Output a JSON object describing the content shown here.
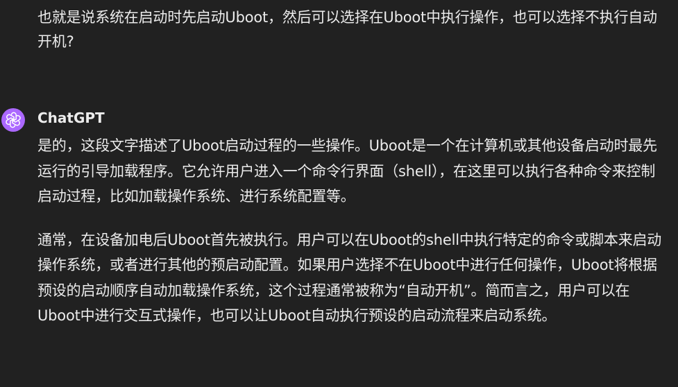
{
  "user_message": {
    "text": "也就是说系统在启动时先启动Uboot，然后可以选择在Uboot中执行操作，也可以选择不执行自动开机?"
  },
  "assistant": {
    "author": "ChatGPT",
    "avatar_icon": "openai-logo-icon",
    "avatar_color": "#ab68ff",
    "paragraphs": [
      "是的，这段文字描述了Uboot启动过程的一些操作。Uboot是一个在计算机或其他设备启动时最先运行的引导加载程序。它允许用户进入一个命令行界面（shell），在这里可以执行各种命令来控制启动过程，比如加载操作系统、进行系统配置等。",
      "通常，在设备加电后Uboot首先被执行。用户可以在Uboot的shell中执行特定的命令或脚本来启动操作系统，或者进行其他的预启动配置。如果用户选择不在Uboot中进行任何操作，Uboot将根据预设的启动顺序自动加载操作系统，这个过程通常被称为“自动开机”。简而言之，用户可以在Uboot中进行交互式操作，也可以让Uboot自动执行预设的启动流程来启动系统。"
    ]
  },
  "colors": {
    "background": "#212121",
    "text": "#ececec"
  }
}
